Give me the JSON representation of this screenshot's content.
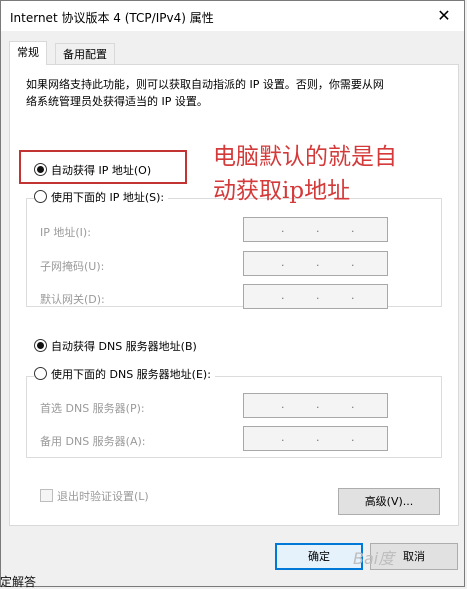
{
  "window": {
    "title": "Internet 协议版本 4 (TCP/IPv4) 属性",
    "close": "✕"
  },
  "tabs": [
    {
      "label": "常规"
    },
    {
      "label": "备用配置"
    }
  ],
  "description_lines": [
    "如果网络支持此功能，则可以获取自动指派的 IP 设置。否则，你需要从网",
    "络系统管理员处获得适当的 IP 设置。"
  ],
  "ip_section": {
    "auto_label": "自动获得 IP 地址(O)",
    "manual_label": "使用下面的 IP 地址(S):",
    "fields": [
      {
        "label": "IP 地址(I):"
      },
      {
        "label": "子网掩码(U):"
      },
      {
        "label": "默认网关(D):"
      }
    ]
  },
  "dns_section": {
    "auto_label": "自动获得 DNS 服务器地址(B)",
    "manual_label": "使用下面的 DNS 服务器地址(E):",
    "fields": [
      {
        "label": "首选 DNS 服务器(P):"
      },
      {
        "label": "备用 DNS 服务器(A):"
      }
    ]
  },
  "ip_dot": ".",
  "validate_label": "退出时验证设置(L)",
  "buttons": {
    "advanced": "高级(V)...",
    "ok": "确定",
    "cancel": "取消"
  },
  "annotation": {
    "line1": "电脑默认的就是自",
    "line2": "动获取ip地址"
  },
  "watermark": "Bai度",
  "cut_text": "定解答",
  "colors": {
    "annotation_red": "#c23434",
    "ok_border": "#0078d7"
  }
}
